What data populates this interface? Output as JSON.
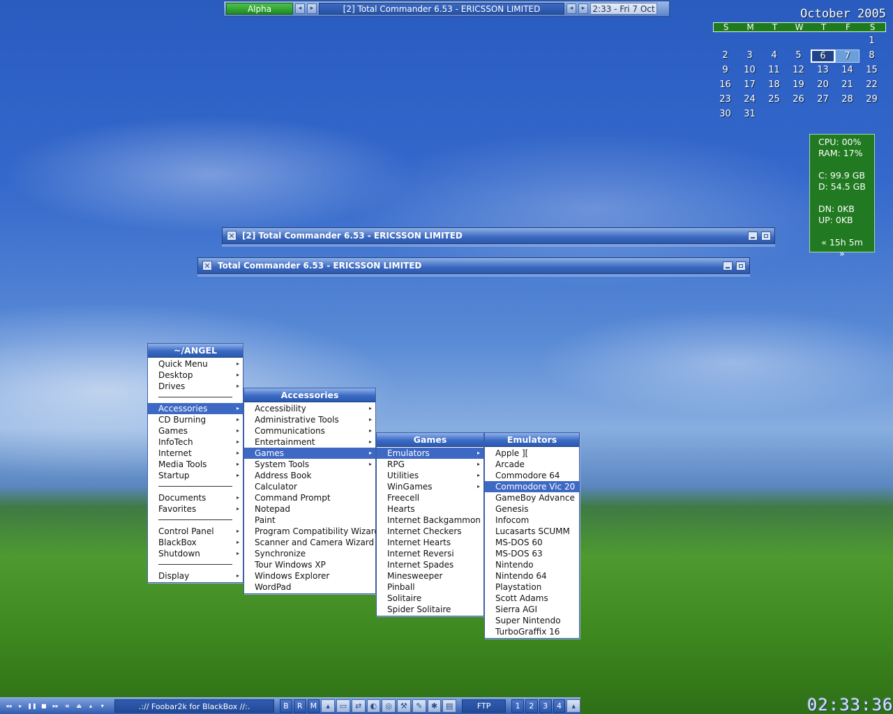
{
  "topbar": {
    "workspace": "Alpha",
    "task": "[2] Total Commander 6.53 - ERICSSON LIMITED",
    "clock": "2:33 - Fri 7 Oct"
  },
  "calendar": {
    "title": "October 2005",
    "days": [
      "S",
      "M",
      "T",
      "W",
      "T",
      "F",
      "S"
    ],
    "weeks": [
      [
        "",
        "",
        "",
        "",
        "",
        "",
        "1"
      ],
      [
        "2",
        "3",
        "4",
        "5",
        "6",
        "7",
        "8"
      ],
      [
        "9",
        "10",
        "11",
        "12",
        "13",
        "14",
        "15"
      ],
      [
        "16",
        "17",
        "18",
        "19",
        "20",
        "21",
        "22"
      ],
      [
        "23",
        "24",
        "25",
        "26",
        "27",
        "28",
        "29"
      ],
      [
        "30",
        "31",
        "",
        "",
        "",
        "",
        ""
      ]
    ],
    "today": "6",
    "selected": "7"
  },
  "stats": {
    "cpu": "CPU: 00%",
    "ram": "RAM: 17%",
    "c_drive": "C: 99.9 GB",
    "d_drive": "D: 54.5 GB",
    "down": "DN: 0KB",
    "up": "UP: 0KB",
    "uptime": "« 15h 5m »"
  },
  "windows": [
    {
      "title": "[2] Total Commander 6.53 - ERICSSON LIMITED"
    },
    {
      "title": "Total Commander 6.53 - ERICSSON LIMITED"
    }
  ],
  "menus": {
    "root": {
      "title": "~/ANGEL",
      "items": [
        "Quick Menu",
        "Desktop",
        "Drives",
        "",
        "Accessories",
        "CD Burning",
        "Games",
        "InfoTech",
        "Internet",
        "Media Tools",
        "Startup",
        "",
        "Documents",
        "Favorites",
        "",
        "Control Panel",
        "BlackBox",
        "Shutdown",
        "",
        "Display"
      ]
    },
    "accessories": {
      "title": "Accessories",
      "items": [
        "Accessibility",
        "Administrative Tools",
        "Communications",
        "Entertainment",
        "Games",
        "System Tools",
        "Address Book",
        "Calculator",
        "Command Prompt",
        "Notepad",
        "Paint",
        "Program Compatibility Wizard",
        "Scanner and Camera Wizard",
        "Synchronize",
        "Tour Windows XP",
        "Windows Explorer",
        "WordPad"
      ]
    },
    "games": {
      "title": "Games",
      "items": [
        "Emulators",
        "RPG",
        "Utilities",
        "WinGames",
        "Freecell",
        "Hearts",
        "Internet Backgammon",
        "Internet Checkers",
        "Internet Hearts",
        "Internet Reversi",
        "Internet Spades",
        "Minesweeper",
        "Pinball",
        "Solitaire",
        "Spider Solitaire"
      ]
    },
    "emulators": {
      "title": "Emulators",
      "items": [
        "Apple ][",
        "Arcade",
        "Commodore 64",
        "Commodore Vic 20",
        "GameBoy Advance",
        "Genesis",
        "Infocom",
        "Lucasarts SCUMM",
        "MS-DOS 60",
        "MS-DOS 63",
        "Nintendo",
        "Nintendo 64",
        "Playstation",
        "Scott Adams",
        "Sierra AGI",
        "Super Nintendo",
        "TurboGraffix 16"
      ]
    }
  },
  "bottombar": {
    "now_playing": ".://  Foobar2k for BlackBox  //:.",
    "keys": [
      "B",
      "R",
      "M"
    ],
    "ftp": "FTP",
    "workspaces": [
      "1",
      "2",
      "3",
      "4"
    ]
  },
  "bigclock": "02:33:36"
}
